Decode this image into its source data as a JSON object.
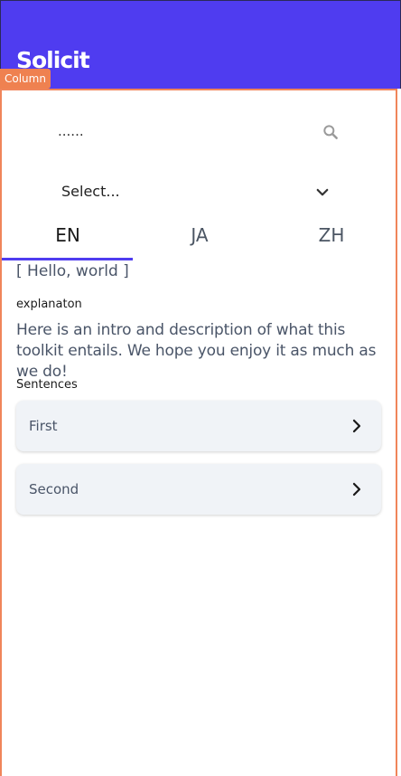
{
  "app_bar": {
    "title": "Solicit",
    "background": "#4f3cf0"
  },
  "debug_overlay": {
    "badge_label": "Column",
    "color": "#ef8150"
  },
  "search": {
    "placeholder": "......",
    "icon": "search-icon"
  },
  "select": {
    "value": "Select...",
    "icon": "chevron-down-icon"
  },
  "tabs": [
    {
      "label": "EN",
      "active": true
    },
    {
      "label": "JA",
      "active": false
    },
    {
      "label": "ZH",
      "active": false
    }
  ],
  "content": {
    "heading": "[ Hello, world ]",
    "explanation_label": "explanaton",
    "intro": "Here is an intro and description of what this toolkit entails. We hope you enjoy it as much as we do!",
    "sentences_label": "Sentences"
  },
  "sentences": [
    {
      "label": "First",
      "icon": "chevron-right-icon"
    },
    {
      "label": "Second",
      "icon": "chevron-right-icon"
    }
  ]
}
